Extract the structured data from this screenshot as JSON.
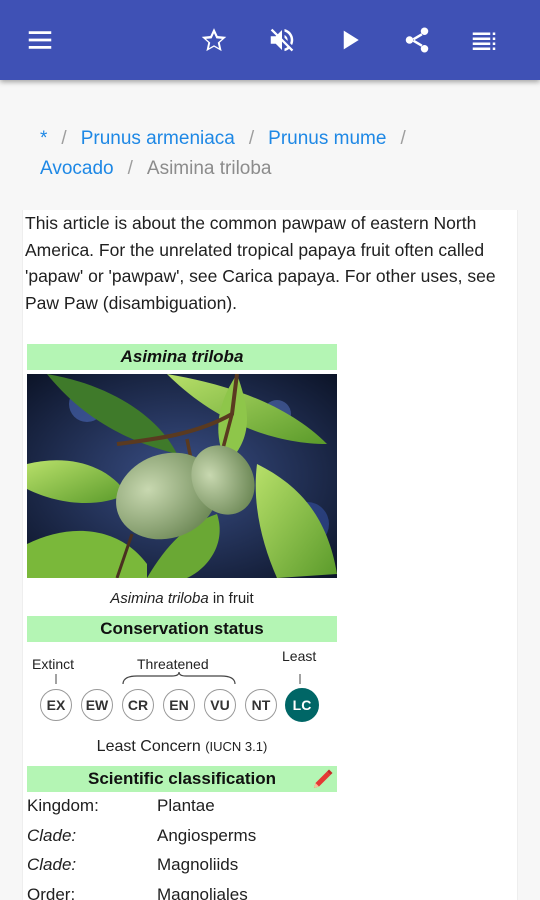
{
  "appbar": {
    "icons": [
      "menu-icon",
      "star-icon",
      "volume-off-icon",
      "play-icon",
      "share-icon",
      "list-icon"
    ]
  },
  "breadcrumb": {
    "items": [
      {
        "label": "*"
      },
      {
        "label": "Prunus armeniaca"
      },
      {
        "label": "Prunus mume"
      },
      {
        "label": "Avocado"
      }
    ],
    "separator": "/",
    "current": "Asimina triloba"
  },
  "article": {
    "hatnote": "This article is about the common pawpaw of eastern North America. For the unrelated tropical papaya fruit often called 'papaw' or 'pawpaw', see Carica papaya. For other uses, see Paw Paw (disambiguation).",
    "infobox": {
      "title": "Asimina triloba",
      "caption_italic": "Asimina triloba",
      "caption_rest": " in fruit",
      "conservation_header": "Conservation status",
      "labels": {
        "extinct": "Extinct",
        "threatened": "Threatened",
        "least1": "Least",
        "least2": "Concern"
      },
      "status_codes": [
        "EX",
        "EW",
        "CR",
        "EN",
        "VU",
        "NT",
        "LC"
      ],
      "active_status": "LC",
      "status_text": "Least Concern",
      "status_source": "(IUCN 3.1)",
      "classification_header": "Scientific classification",
      "taxonomy": [
        {
          "key": "Kingdom:",
          "value": "Plantae",
          "italic_key": false
        },
        {
          "key": "Clade",
          "value": "Angiosperms",
          "italic_key": true
        },
        {
          "key": "Clade",
          "value": "Magnoliids",
          "italic_key": true
        },
        {
          "key": "Order:",
          "value": "Magnoliales",
          "italic_key": false
        }
      ]
    }
  },
  "colors": {
    "appbar": "#3f51b5",
    "link": "#1e88e5",
    "infobox_header": "#b4f5b4",
    "least_concern": "#006666"
  }
}
